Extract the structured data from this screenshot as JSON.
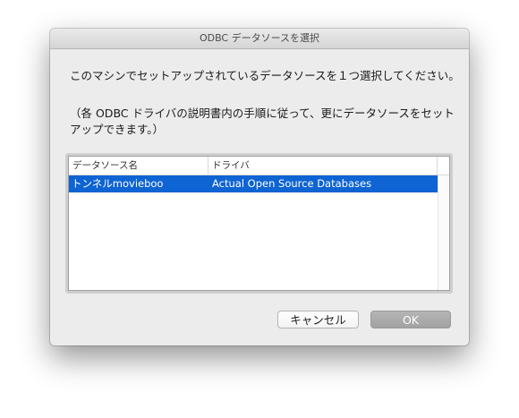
{
  "window": {
    "title": "ODBC データソースを選択"
  },
  "message": {
    "line1": "このマシンでセットアップされているデータソースを１つ選択してください。",
    "line2": "（各 ODBC ドライバの説明書内の手順に従って、更にデータソースをセットアップできます。）"
  },
  "table": {
    "columns": [
      "データソース名",
      "ドライバ"
    ],
    "rows": [
      {
        "name": "トンネルmovieboo",
        "driver": "Actual Open Source Databases",
        "selected": true
      }
    ]
  },
  "buttons": {
    "cancel_label": "キャンセル",
    "ok_label": "OK"
  },
  "colors": {
    "selection": "#0e64d2",
    "window_bg": "#ececec",
    "ok_disabled": "#a8a8a8"
  }
}
